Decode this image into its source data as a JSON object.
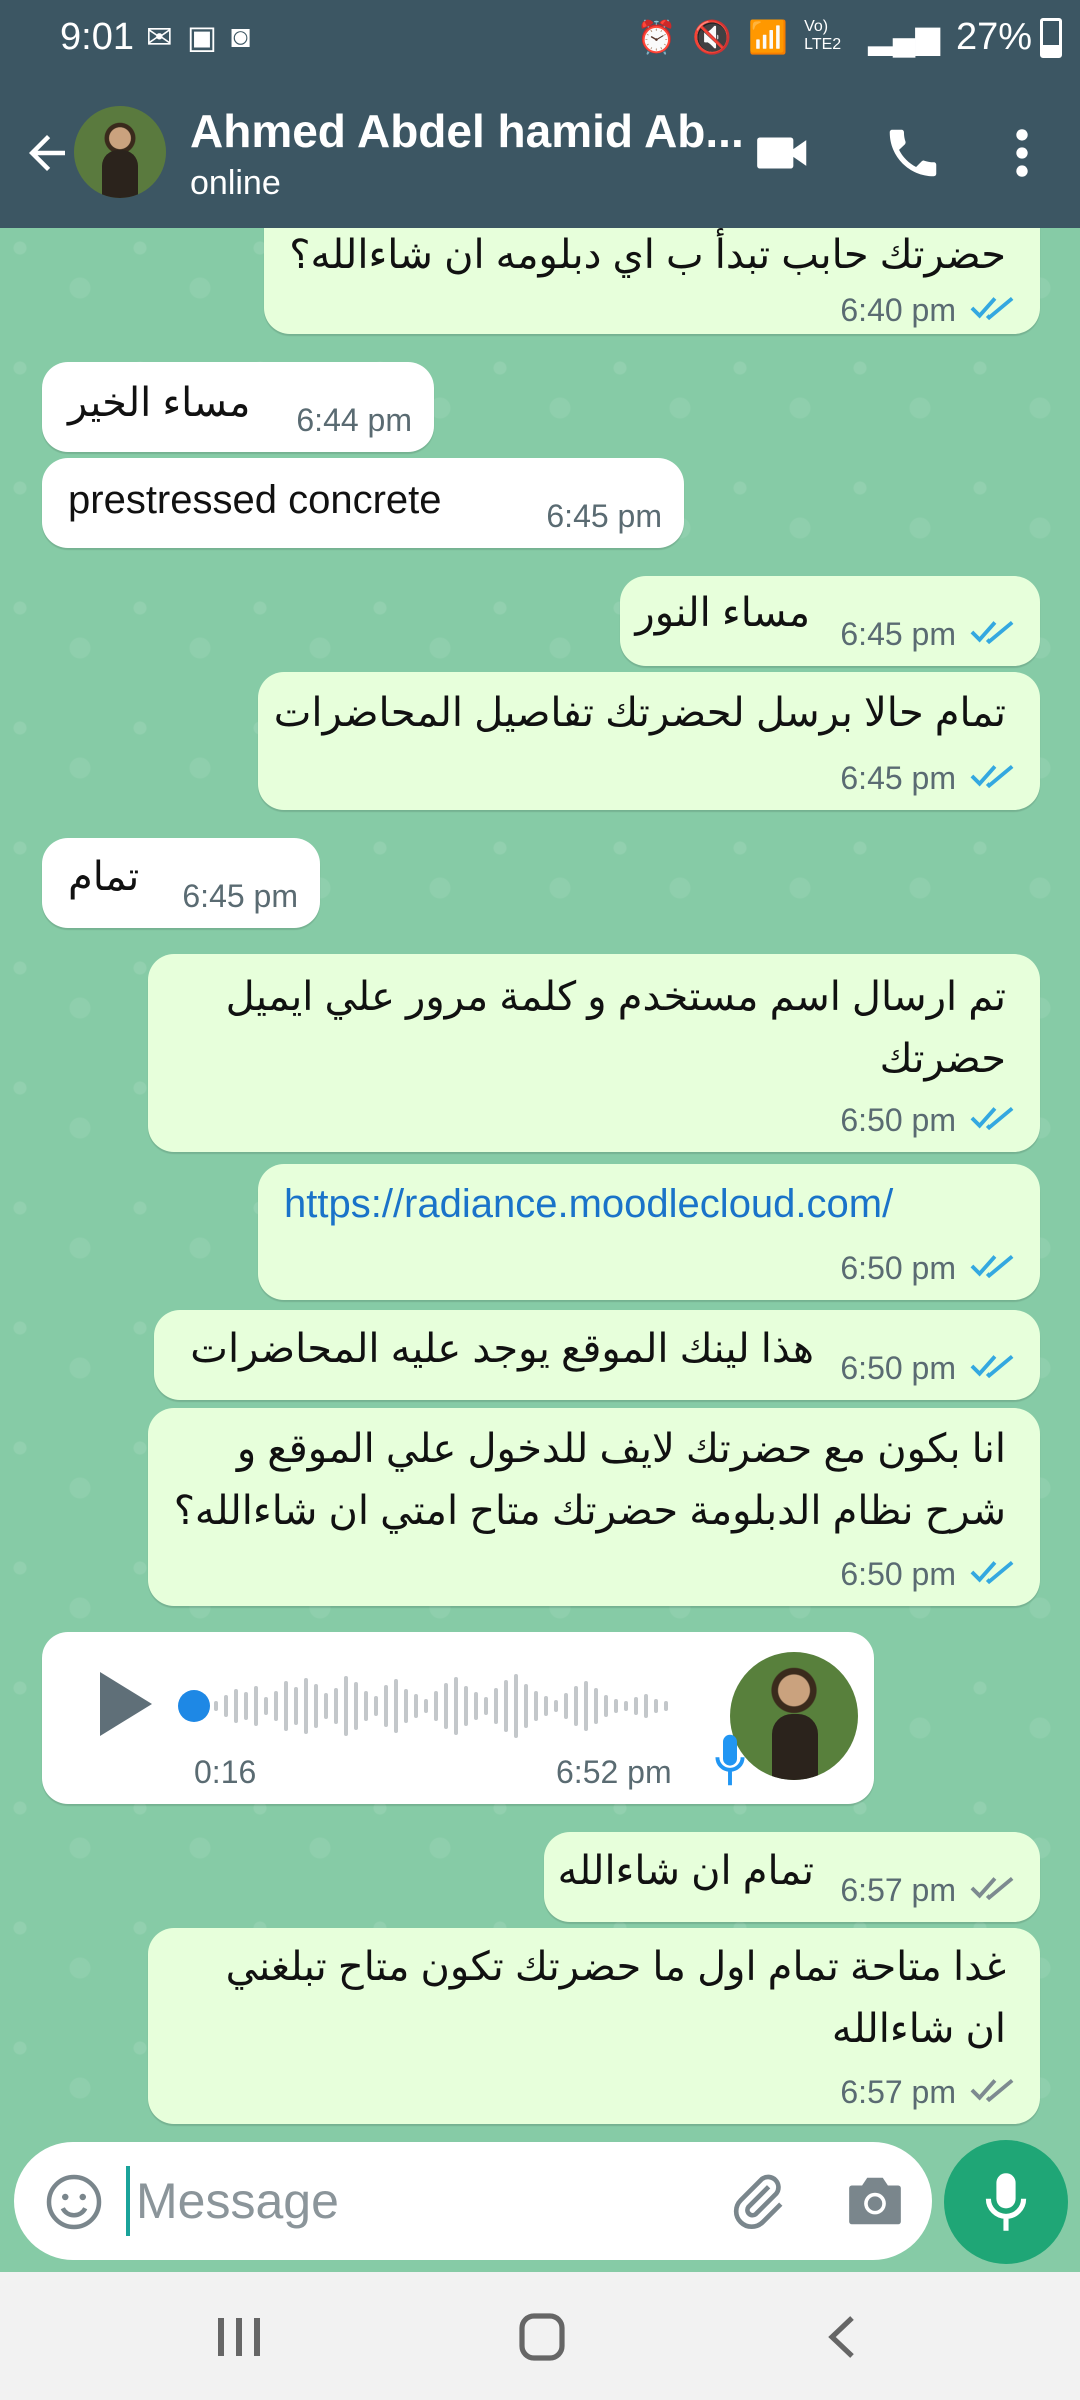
{
  "status_bar": {
    "time": "9:01",
    "battery": "27%",
    "network": "Vo) LTE2"
  },
  "header": {
    "contact_name": "Ahmed Abdel hamid Ab...",
    "status": "online",
    "icons": [
      "back-arrow-icon",
      "video-call-icon",
      "phone-call-icon",
      "more-options-icon"
    ]
  },
  "messages": [
    {
      "dir": "out",
      "text": "حضرتك حابب تبدأ ب اي دبلومه ان شاءالله؟",
      "time": "6:40 pm",
      "status": "read"
    },
    {
      "dir": "in",
      "text": "مساء الخير",
      "time": "6:44 pm"
    },
    {
      "dir": "in",
      "text": "prestressed concrete",
      "time": "6:45 pm"
    },
    {
      "dir": "out",
      "text": "مساء النور",
      "time": "6:45 pm",
      "status": "read"
    },
    {
      "dir": "out",
      "text": "تمام حالا برسل لحضرتك تفاصيل المحاضرات",
      "time": "6:45 pm",
      "status": "read"
    },
    {
      "dir": "in",
      "text": "تمام",
      "time": "6:45 pm"
    },
    {
      "dir": "out",
      "lines": [
        "تم ارسال اسم مستخدم و كلمة مرور علي ايميل",
        "حضرتك"
      ],
      "time": "6:50 pm",
      "status": "read"
    },
    {
      "dir": "out",
      "link": "https://radiance.moodlecloud.com/",
      "time": "6:50 pm",
      "status": "read"
    },
    {
      "dir": "out",
      "text": "هذا لينك الموقع يوجد عليه المحاضرات",
      "time": "6:50 pm",
      "status": "read"
    },
    {
      "dir": "out",
      "lines": [
        "انا بكون مع حضرتك لايف للدخول علي الموقع و",
        "شرح نظام الدبلومة حضرتك متاح امتي ان شاءالله؟"
      ],
      "time": "6:50 pm",
      "status": "read"
    },
    {
      "dir": "in",
      "type": "voice",
      "duration": "0:16",
      "time": "6:52 pm"
    },
    {
      "dir": "out",
      "text": "تمام ان شاءالله",
      "time": "6:57 pm",
      "status": "delivered"
    },
    {
      "dir": "out",
      "lines": [
        "غدا متاحة تمام  اول ما حضرتك تكون متاح تبلغني",
        "ان شاءالله"
      ],
      "time": "6:57 pm",
      "status": "delivered"
    }
  ],
  "composer": {
    "placeholder": "Message"
  },
  "colors": {
    "header": "#3c5663",
    "chat_bg": "#86cba6",
    "outgoing": "#e7ffdb",
    "incoming": "#ffffff",
    "read_ticks": "#34a8e0",
    "delivered_ticks": "#7d8a90",
    "mic_button": "#1fa676",
    "link": "#1a73c9"
  }
}
